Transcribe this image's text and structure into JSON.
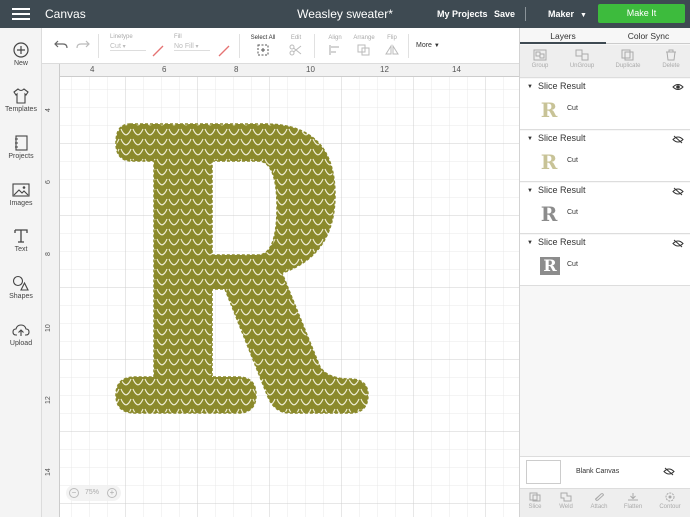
{
  "topbar": {
    "app_title": "Canvas",
    "document_title": "Weasley sweater*",
    "my_projects": "My Projects",
    "save": "Save",
    "machine": "Maker",
    "make_it": "Make It"
  },
  "sidebar": {
    "items": [
      {
        "label": "New",
        "icon": "plus-circle-icon"
      },
      {
        "label": "Templates",
        "icon": "shirt-icon"
      },
      {
        "label": "Projects",
        "icon": "notebook-icon"
      },
      {
        "label": "Images",
        "icon": "image-icon"
      },
      {
        "label": "Text",
        "icon": "text-icon"
      },
      {
        "label": "Shapes",
        "icon": "shapes-icon"
      },
      {
        "label": "Upload",
        "icon": "cloud-upload-icon"
      }
    ]
  },
  "toolbar": {
    "linetype_label": "Linetype",
    "linetype_value": "Cut",
    "fill_label": "Fill",
    "fill_value": "No Fill",
    "select_all": "Select All",
    "edit": "Edit",
    "align": "Align",
    "arrange": "Arrange",
    "flip": "Flip",
    "more": "More"
  },
  "rulers": {
    "top": [
      "4",
      "6",
      "8",
      "10",
      "12",
      "14"
    ],
    "left": [
      "4",
      "6",
      "8",
      "10",
      "12",
      "14"
    ]
  },
  "canvas": {
    "zoom": "75%",
    "zoom_out": "−",
    "zoom_in": "+",
    "design_color": "#8b8a2c",
    "pattern_color": "#f2f0d8"
  },
  "panel": {
    "tabs": [
      "Layers",
      "Color Sync"
    ],
    "tools": [
      "Group",
      "UnGroup",
      "Duplicate",
      "Delete"
    ],
    "layers": [
      {
        "name": "Slice Result",
        "operation": "Cut",
        "thumb": "R",
        "thumb_color": "#c8c397",
        "visible": true
      },
      {
        "name": "Slice Result",
        "operation": "Cut",
        "thumb": "R",
        "thumb_color": "#c8c397",
        "visible": false
      },
      {
        "name": "Slice Result",
        "operation": "Cut",
        "thumb": "R",
        "thumb_color": "#8c8c8c",
        "visible": false
      },
      {
        "name": "Slice Result",
        "operation": "Cut",
        "thumb": "R",
        "thumb_color": "#8c8c8c",
        "visible": false
      }
    ],
    "blank_canvas": "Blank Canvas",
    "bottom_tools": [
      "Slice",
      "Weld",
      "Attach",
      "Flatten",
      "Contour"
    ]
  }
}
